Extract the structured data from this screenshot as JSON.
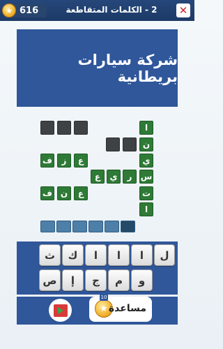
{
  "header": {
    "coins": "616",
    "level_title": "2 - الكلمات المتقاطعة",
    "close_label": "✕"
  },
  "clue": {
    "text": "شركة سيارات بريطانية"
  },
  "grid": {
    "vertical": [
      "ا",
      "ن",
      "ي",
      "س",
      "ت",
      "ا"
    ],
    "row_izz": [
      "ف",
      "ز",
      "ع"
    ],
    "row_riya": [
      "ع",
      "ي",
      "ر"
    ],
    "row_aun": [
      "ف",
      "ن",
      "ع"
    ]
  },
  "keyboard": {
    "row1": [
      "ث",
      "ك",
      "ا",
      "ا",
      "ا",
      "ل"
    ],
    "row2": [
      "ص",
      "إ",
      "ج",
      "م",
      "و"
    ]
  },
  "bottom": {
    "help_label": "مساعدة",
    "help_cost": "10"
  }
}
